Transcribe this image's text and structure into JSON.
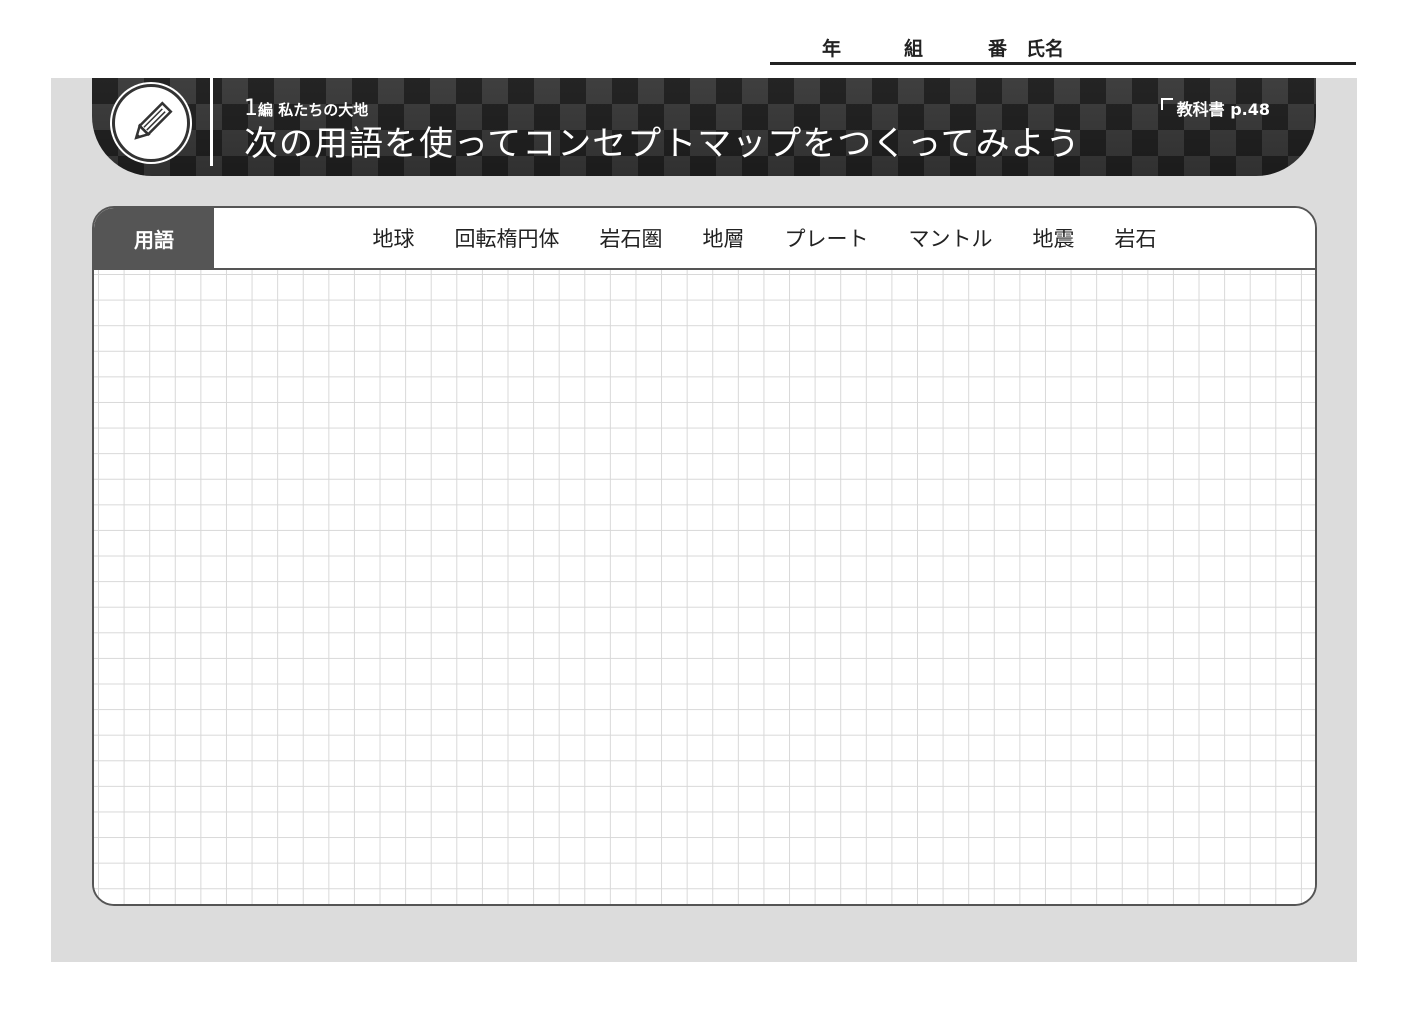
{
  "name_line": {
    "year": "年",
    "class": "組",
    "number": "番",
    "name": "氏名"
  },
  "header": {
    "section_number": "1",
    "section_unit": "編",
    "section_title": "私たちの大地",
    "title": "次の用語を使ってコンセプトマップをつくってみよう",
    "textbook_ref": "教科書 p.48",
    "icon": "pencil-icon"
  },
  "terms": {
    "label": "用語",
    "items": [
      "地球",
      "回転楕円体",
      "岩石圏",
      "地層",
      "プレート",
      "マントル",
      "地震",
      "岩石"
    ]
  },
  "colors": {
    "panel": "#dcdcdc",
    "banner_dark": "#2a2a2a",
    "banner_light": "#4a4a4a",
    "label_bg": "#555555",
    "grid_line": "#d8d8d8"
  }
}
